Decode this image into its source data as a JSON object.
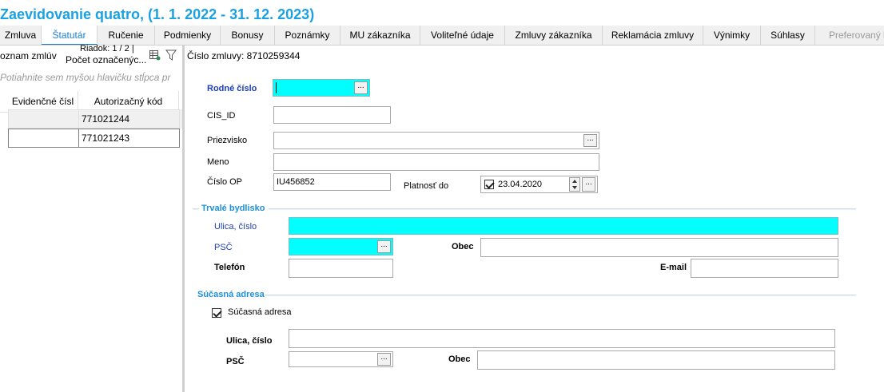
{
  "window": {
    "title": "Zaevidovanie quatro,  (1. 1. 2022 - 31. 12. 2023)"
  },
  "tabs": [
    {
      "label": "Zmluva",
      "active": false,
      "disabled": false
    },
    {
      "label": "Štatutár",
      "active": true,
      "disabled": false
    },
    {
      "label": "Ručenie",
      "active": false,
      "disabled": false
    },
    {
      "label": "Podmienky",
      "active": false,
      "disabled": false
    },
    {
      "label": "Bonusy",
      "active": false,
      "disabled": false
    },
    {
      "label": "Poznámky",
      "active": false,
      "disabled": false
    },
    {
      "label": "MU zákazníka",
      "active": false,
      "disabled": false
    },
    {
      "label": "Voliteľné údaje",
      "active": false,
      "disabled": false
    },
    {
      "label": "Zmluvy zákazníka",
      "active": false,
      "disabled": false
    },
    {
      "label": "Reklamácia zmluvy",
      "active": false,
      "disabled": false
    },
    {
      "label": "Výnimky",
      "active": false,
      "disabled": false
    },
    {
      "label": "Súhlasy",
      "active": false,
      "disabled": false
    },
    {
      "label": "Preferovaný k",
      "active": false,
      "disabled": true
    }
  ],
  "left": {
    "list_label": "oznam zmlúv",
    "row_info": "Riadok: 1 / 2 |",
    "marked_count": "Počet označenýc...",
    "group_hint": "Potiahnite sem myšou hlavičku stĺpca pr",
    "columns": [
      "Evidenčné čísl",
      "Autorizačný kód"
    ],
    "rows": [
      {
        "evid": "",
        "auth": "771021244"
      },
      {
        "evid": "",
        "auth": "771021243"
      }
    ]
  },
  "form": {
    "contract_number": "Číslo zmluvy: 8710259344",
    "rodne_cislo": {
      "label": "Rodné číslo",
      "value": ""
    },
    "cis_id": {
      "label": "CIS_ID",
      "value": ""
    },
    "priezvisko": {
      "label": "Priezvisko",
      "value": ""
    },
    "meno": {
      "label": "Meno",
      "value": ""
    },
    "cislo_op": {
      "label": "Číslo OP",
      "value": "IU456852"
    },
    "platnost_do": {
      "label": "Platnosť do",
      "value": "23.04.2020",
      "checked": true
    },
    "trvale": {
      "title": "Trvalé bydlisko",
      "ulica_label": "Ulica, číslo",
      "ulica_value": "",
      "psc_label": "PSČ",
      "psc_value": "",
      "obec_label": "Obec",
      "obec_value": "",
      "telefon_label": "Telefón",
      "telefon_value": "",
      "email_label": "E-mail",
      "email_value": ""
    },
    "sucasna": {
      "title": "Súčasná adresa",
      "checkbox_label": "Súčasná adresa",
      "checked": true,
      "ulica_label": "Ulica, číslo",
      "ulica_value": "",
      "psc_label": "PSČ",
      "psc_value": "",
      "obec_label": "Obec",
      "obec_value": ""
    },
    "ellipsis": "..."
  },
  "colors": {
    "title": "#1ba1e2",
    "required_field": "#00ffff",
    "required_label": "#1f3fb5",
    "section": "#1f8fd8"
  }
}
